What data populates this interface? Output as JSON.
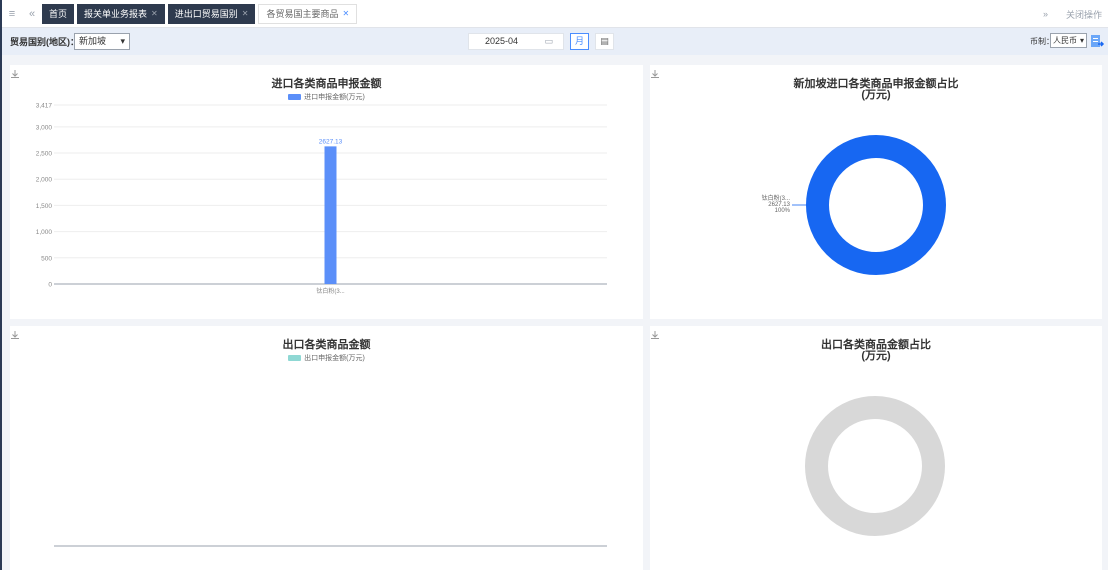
{
  "tabbar": {
    "tabs": [
      {
        "label": "首页",
        "closable": false,
        "active": false
      },
      {
        "label": "报关单业务报表",
        "closable": true,
        "active": false
      },
      {
        "label": "进出口贸易国别",
        "closable": true,
        "active": false
      },
      {
        "label": "各贸易国主要商品",
        "closable": true,
        "active": true
      }
    ],
    "close_ops": "关闭操作"
  },
  "filter": {
    "country_label": "贸易国别(地区)：",
    "country_value": "新加坡",
    "date_value": "2025-04",
    "month_btn": "月",
    "currency_label": "币制：",
    "currency_value": "人民币"
  },
  "colors": {
    "import_bar": "#5b8ff9",
    "export_legend": "#8fd8d4",
    "import_donut": "#1767f2",
    "export_donut": "#d8d8d8"
  },
  "chart_data": [
    {
      "type": "bar",
      "title": "进口各类商品申报金额",
      "series": [
        {
          "name": "进口申报金额(万元)",
          "values": [
            2627.13
          ]
        }
      ],
      "categories": [
        "钛白粉(3..."
      ],
      "data_labels": [
        "2627.13"
      ],
      "yticks": [
        "3,417",
        "3,000",
        "2,500",
        "2,000",
        "1,500",
        "1,000",
        "500",
        "0"
      ],
      "ylim": [
        0,
        3417
      ],
      "grid": true,
      "legend": "top"
    },
    {
      "type": "pie",
      "title_line1": "新加坡进口各类商品申报金额占比",
      "title_line2": "(万元)",
      "slices": [
        {
          "label": "钛白粉(3...",
          "value": 2627.13,
          "value_label": "2627.13",
          "percent": "100%"
        }
      ]
    },
    {
      "type": "bar",
      "title": "出口各类商品金额",
      "series": [
        {
          "name": "出口申报金额(万元)",
          "values": []
        }
      ],
      "categories": [],
      "legend": "top"
    },
    {
      "type": "pie",
      "title_line1": "出口各类商品金额占比",
      "title_line2": "(万元)",
      "slices": []
    }
  ]
}
